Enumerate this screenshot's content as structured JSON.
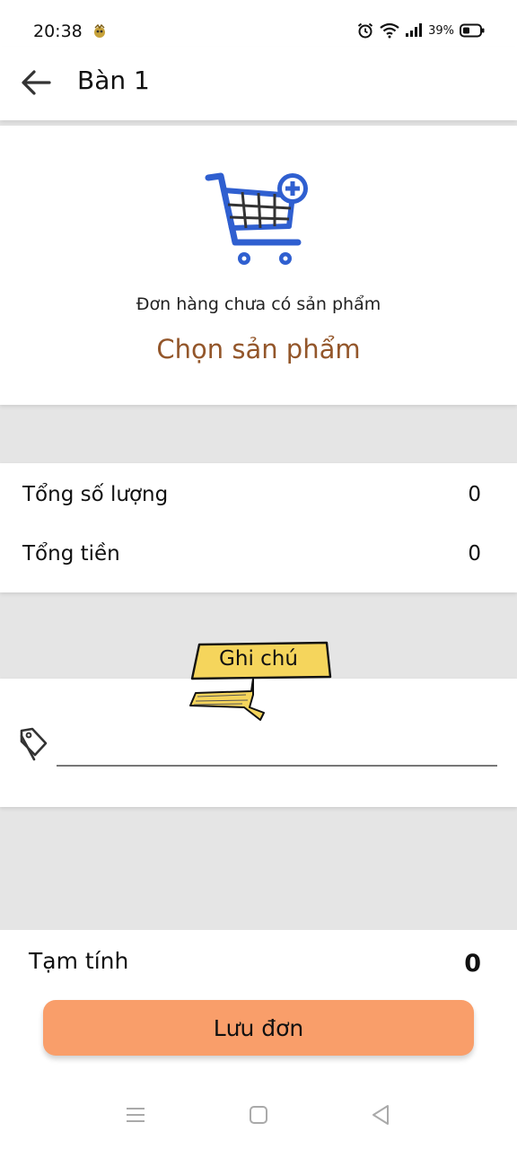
{
  "status_bar": {
    "time": "20:38",
    "battery_text": "39%",
    "icons": [
      "alarm-icon",
      "wifi-icon",
      "signal-icon",
      "battery-icon"
    ]
  },
  "header": {
    "title": "Bàn 1",
    "back_icon": "arrow-left-icon"
  },
  "empty_order": {
    "icon": "cart-plus-icon",
    "message": "Đơn hàng chưa có sản phẩm",
    "choose_label": "Chọn sản phẩm",
    "choose_color": "#93562a"
  },
  "totals": {
    "quantity_label": "Tổng số lượng",
    "quantity_value": "0",
    "amount_label": "Tổng tiền",
    "amount_value": "0"
  },
  "note": {
    "sticker_label": "Ghi chú",
    "icon": "tag-icon",
    "input_value": "",
    "input_placeholder": ""
  },
  "footer": {
    "subtotal_label": "Tạm tính",
    "subtotal_value": "0",
    "save_label": "Lưu đơn",
    "save_color": "#f99e6a"
  },
  "nav_bar": {
    "buttons": [
      "menu-icon",
      "home-icon",
      "back-triangle-icon"
    ]
  },
  "colors": {
    "background": "#e5e5e5",
    "card": "#ffffff",
    "accent_blue": "#2f5fd0"
  }
}
